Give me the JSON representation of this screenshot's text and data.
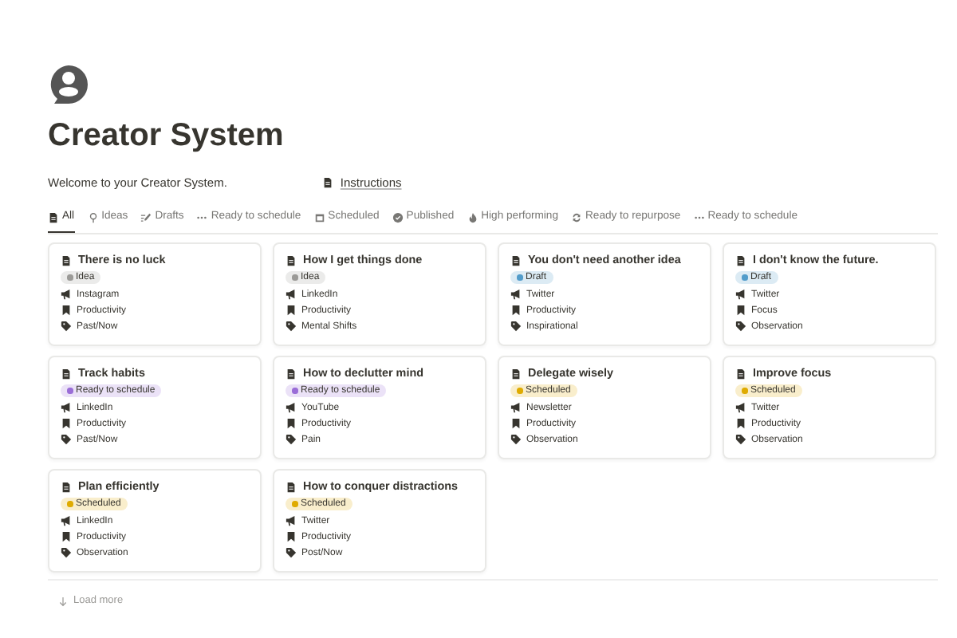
{
  "page": {
    "title": "Creator System",
    "intro": "Welcome to your Creator System.",
    "link": "Instructions"
  },
  "tabs": [
    {
      "label": "All",
      "selected": true
    },
    {
      "label": "Ideas",
      "selected": false
    },
    {
      "label": "Drafts",
      "selected": false
    },
    {
      "label": "Ready to schedule",
      "selected": false
    },
    {
      "label": "Scheduled",
      "selected": false
    },
    {
      "label": "Published",
      "selected": false
    },
    {
      "label": "High performing",
      "selected": false
    },
    {
      "label": "Ready to repurpose",
      "selected": false
    },
    {
      "label": "Ready to schedule",
      "selected": false
    }
  ],
  "cards": [
    {
      "title": "There is no luck",
      "status": {
        "label": "Idea",
        "color": "#9b9a97"
      },
      "platform": "Instagram",
      "topic": "Productivity",
      "tag": "Past/Now"
    },
    {
      "title": "How I get things done",
      "status": {
        "label": "Idea",
        "color": "#9b9a97"
      },
      "platform": "LinkedIn",
      "topic": "Productivity",
      "tag": "Mental Shifts"
    },
    {
      "title": "You don't need another idea",
      "status": {
        "label": "Draft",
        "color": "#529cca"
      },
      "platform": "Twitter",
      "topic": "Productivity",
      "tag": "Inspirational"
    },
    {
      "title": "I don't know the future.",
      "status": {
        "label": "Draft",
        "color": "#529cca"
      },
      "platform": "Twitter",
      "topic": "Focus",
      "tag": "Observation"
    },
    {
      "title": "Track habits",
      "status": {
        "label": "Ready to schedule",
        "color": "#9a6dd7"
      },
      "platform": "LinkedIn",
      "topic": "Productivity",
      "tag": "Past/Now"
    },
    {
      "title": "How to declutter mind",
      "status": {
        "label": "Ready to schedule",
        "color": "#9a6dd7"
      },
      "platform": "YouTube",
      "topic": "Productivity",
      "tag": "Pain"
    },
    {
      "title": "Delegate wisely",
      "status": {
        "label": "Scheduled",
        "color": "#dfab01"
      },
      "platform": "Newsletter",
      "topic": "Productivity",
      "tag": "Observation"
    },
    {
      "title": "Improve focus",
      "status": {
        "label": "Scheduled",
        "color": "#dfab01"
      },
      "platform": "Twitter",
      "topic": "Productivity",
      "tag": "Observation"
    },
    {
      "title": "Plan efficiently",
      "status": {
        "label": "Scheduled",
        "color": "#dfab01"
      },
      "platform": "LinkedIn",
      "topic": "Productivity",
      "tag": "Observation"
    },
    {
      "title": "How to conquer distractions",
      "status": {
        "label": "Scheduled",
        "color": "#dfab01"
      },
      "platform": "Twitter",
      "topic": "Productivity",
      "tag": "Post/Now"
    }
  ],
  "load_more": "Load more"
}
